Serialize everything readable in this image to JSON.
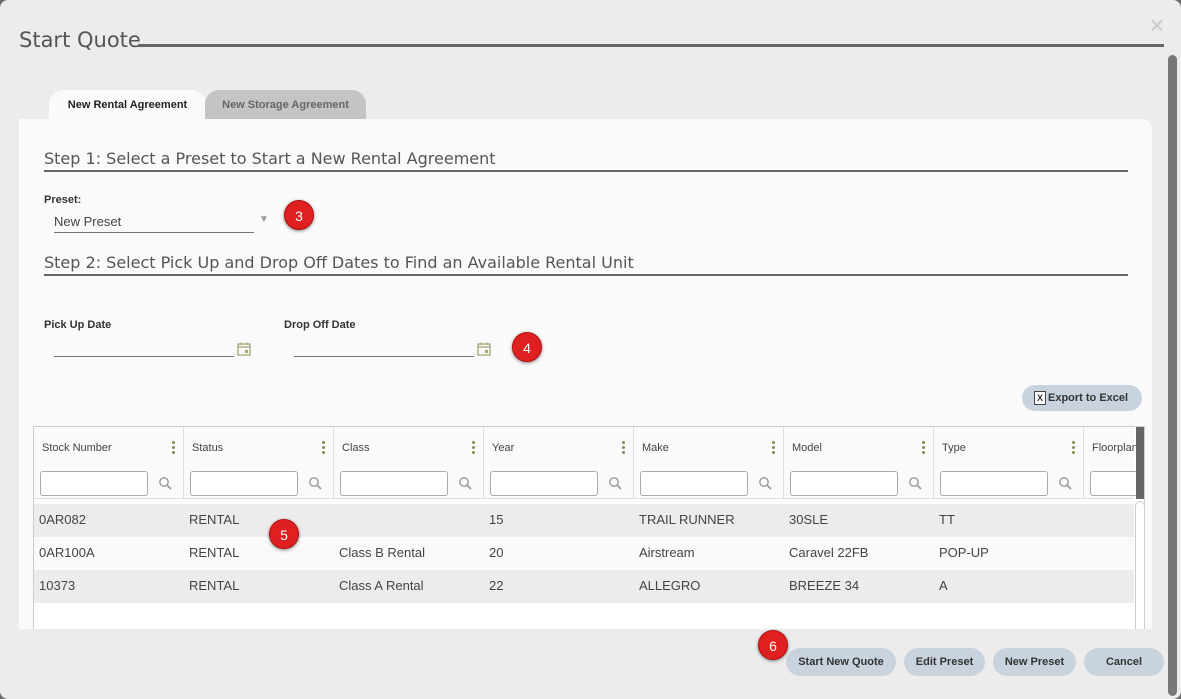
{
  "dialog": {
    "title": "Start Quote",
    "close_label": "×"
  },
  "tabs": [
    {
      "label": "New Rental Agreement",
      "active": true
    },
    {
      "label": "New Storage Agreement",
      "active": false
    }
  ],
  "step1": {
    "heading": "Step 1: Select a Preset to Start a New Rental Agreement",
    "preset_label": "Preset:",
    "preset_value": "New Preset"
  },
  "step2": {
    "heading": "Step 2: Select Pick Up and Drop Off Dates to Find an Available Rental Unit",
    "pickup_label": "Pick Up Date",
    "pickup_value": "",
    "dropoff_label": "Drop Off Date",
    "dropoff_value": ""
  },
  "export_label": "Export to Excel",
  "grid": {
    "columns": [
      "Stock Number",
      "Status",
      "Class",
      "Year",
      "Make",
      "Model",
      "Type",
      "Floorplan"
    ],
    "rows": [
      [
        "0AR082",
        "RENTAL",
        "",
        "15",
        "TRAIL RUNNER",
        "30SLE",
        "TT"
      ],
      [
        "0AR100A",
        "RENTAL",
        "Class B Rental",
        "20",
        "Airstream",
        "Caravel 22FB",
        "POP-UP"
      ],
      [
        "10373",
        "RENTAL",
        "Class A Rental",
        "22",
        "ALLEGRO",
        "BREEZE 34",
        "A"
      ]
    ]
  },
  "markers": [
    "3",
    "4",
    "5",
    "6"
  ],
  "footer": {
    "start_new_quote": "Start New Quote",
    "edit_preset": "Edit Preset",
    "new_preset": "New Preset",
    "cancel": "Cancel"
  },
  "colors": {
    "accent_button": "#c8d3de",
    "marker": "#e02020"
  }
}
